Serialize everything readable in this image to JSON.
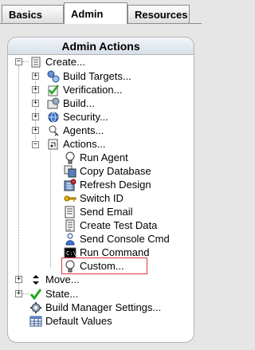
{
  "tabs": [
    {
      "label": "Basics",
      "active": false
    },
    {
      "label": "Admin",
      "active": true
    },
    {
      "label": "Resources",
      "active": false
    }
  ],
  "panel": {
    "title": "Admin Actions"
  },
  "tree": {
    "create": {
      "label": "Create...",
      "expander": "−"
    },
    "build_targets": {
      "label": "Build Targets...",
      "expander": "+"
    },
    "verification": {
      "label": "Verification...",
      "expander": "+"
    },
    "build": {
      "label": "Build...",
      "expander": "+"
    },
    "security": {
      "label": "Security...",
      "expander": "+"
    },
    "agents": {
      "label": "Agents...",
      "expander": "+"
    },
    "actions": {
      "label": "Actions...",
      "expander": "−"
    },
    "action_items": [
      {
        "label": "Run Agent"
      },
      {
        "label": "Copy Database"
      },
      {
        "label": "Refresh Design"
      },
      {
        "label": "Switch ID"
      },
      {
        "label": "Send Email"
      },
      {
        "label": "Create Test Data"
      },
      {
        "label": "Send Console Cmd"
      },
      {
        "label": "Run Command"
      },
      {
        "label": "Custom..."
      }
    ],
    "move": {
      "label": "Move...",
      "expander": "+"
    },
    "state": {
      "label": "State...",
      "expander": "+"
    },
    "build_manager_settings": {
      "label": "Build Manager Settings..."
    },
    "default_values": {
      "label": "Default Values"
    }
  }
}
